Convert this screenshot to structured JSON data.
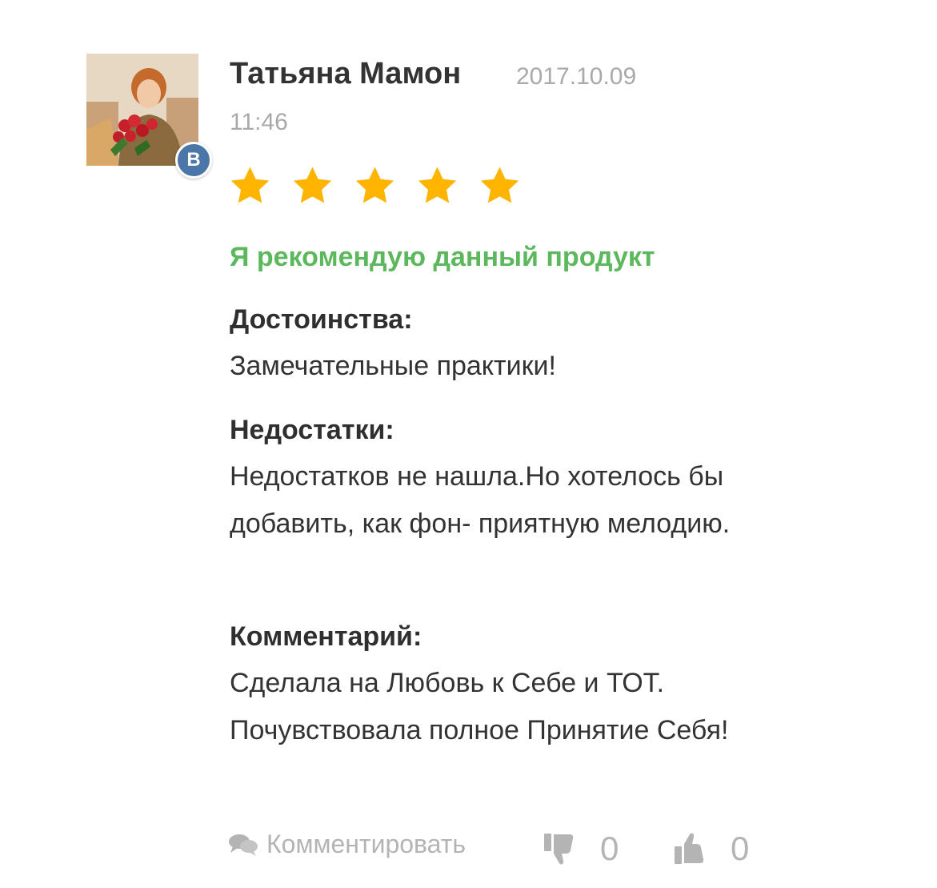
{
  "review": {
    "author": "Татьяна Мамон",
    "date": "2017.10.09",
    "time": "11:46",
    "rating": 5,
    "rating_max": 5,
    "social_badge": "B",
    "recommend_text": "Я рекомендую данный продукт",
    "pros_title": "Достоинства:",
    "pros_text": "Замечательные практики!",
    "cons_title": "Недостатки:",
    "cons_text": "Недостатков не нашла.Но хотелось бы добавить, как фон- приятную мелодию.",
    "comment_title": "Комментарий:",
    "comment_text": "Сделала на Любовь к Себе и ТОТ. Почувствовала полное Принятие Себя!"
  },
  "footer": {
    "comment_label": "Комментировать",
    "dislike_count": "0",
    "like_count": "0"
  },
  "colors": {
    "star": "#ffb400",
    "recommend": "#5cb85c",
    "muted": "#b4b4b4",
    "vk": "#4a76a8"
  },
  "icons": {
    "comment": "speech-bubbles-icon",
    "dislike": "thumbs-down-icon",
    "like": "thumbs-up-icon",
    "star": "star-icon"
  }
}
